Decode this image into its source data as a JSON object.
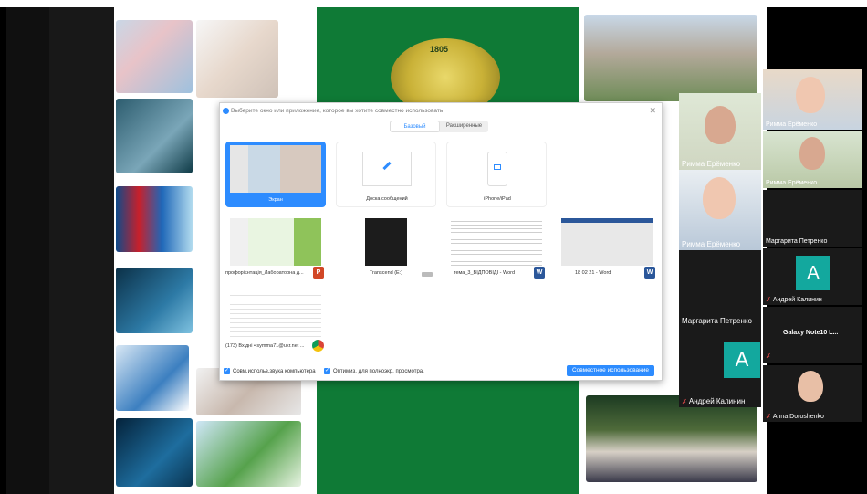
{
  "dialog": {
    "title": "Выберите окно или приложение, которое вы хотите совместно использовать",
    "tabs": [
      {
        "label": "Базовый",
        "active": true
      },
      {
        "label": "Расширенные",
        "active": false
      }
    ],
    "options": [
      {
        "label": "Экран",
        "selected": true
      },
      {
        "label": "Доска сообщений"
      },
      {
        "label": "iPhone/iPad"
      }
    ],
    "windows": [
      {
        "label": "профорієнтація_Лабораторна д...",
        "app": "P"
      },
      {
        "label": "Transcend (E:)",
        "app": ""
      },
      {
        "label": "тема_3_ВІДПОВІДІ - Word",
        "app": "W"
      },
      {
        "label": "18 02 21 - Word",
        "app": "W"
      },
      {
        "label": "(173) Вхідні • symma71@ukr.net ...",
        "app": ""
      }
    ],
    "checkbox_audio": "Совм.использ.звука компьютера",
    "checkbox_optimize": "Оптимиз. для полноэкр. просмотра.",
    "share_button": "Совместное использование"
  },
  "crest_year": "1805",
  "participants": [
    {
      "name": "Римма Ерёменко"
    },
    {
      "name": "Римма Ерёменко"
    },
    {
      "name": "Римма Ерёменко"
    },
    {
      "name": "Маргарита Петренко"
    },
    {
      "name": "Маргарита Петренко"
    },
    {
      "name": "Андрей Калинин",
      "avatar_letter": "A",
      "muted": true
    },
    {
      "name": "Андрей Калинин",
      "avatar_letter": "A",
      "muted": true
    },
    {
      "name": "Galaxy Note10 L..."
    },
    {
      "name": "Римма Ерёменко"
    },
    {
      "name": "Anna Doroshenko",
      "muted": true
    }
  ],
  "colors": {
    "accent": "#2d8cff",
    "green": "#0f7a36",
    "avatar": "#13a89e",
    "mic_off": "#e24b4b"
  }
}
